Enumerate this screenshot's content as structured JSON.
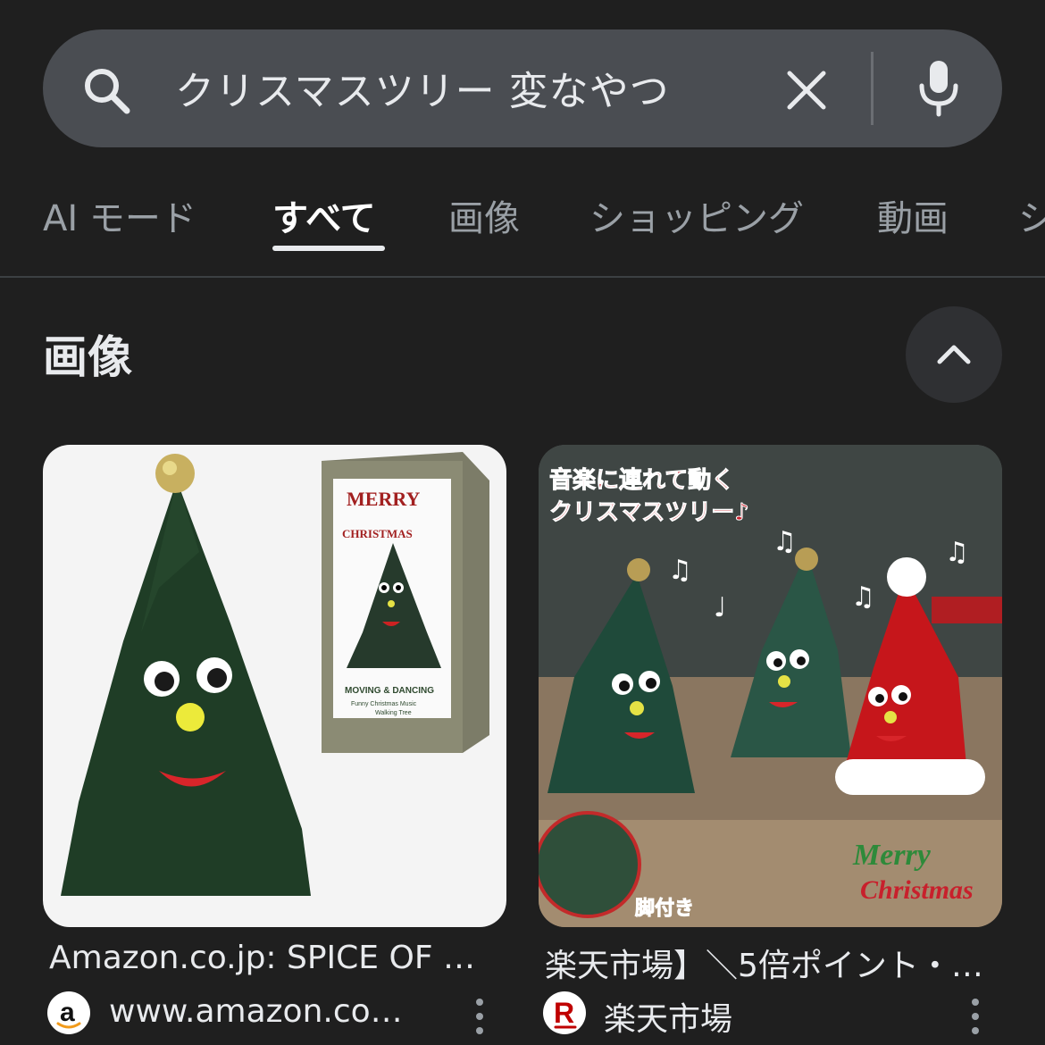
{
  "search": {
    "query": "クリスマスツリー 変なやつ",
    "icons": [
      "search-icon",
      "clear-icon",
      "mic-icon"
    ]
  },
  "tabs": [
    {
      "label": "AI モード"
    },
    {
      "label": "すべて",
      "active": true
    },
    {
      "label": "画像"
    },
    {
      "label": "ショッピング"
    },
    {
      "label": "動画"
    },
    {
      "label": "シ"
    }
  ],
  "images_section": {
    "title": "画像",
    "toggle_icon": "chevron-up-icon"
  },
  "results": [
    {
      "title": "Amazon.co.jp: SPICE OF …",
      "source": "www.amazon.co…",
      "favicon": "amazon-logo",
      "package_text": [
        "MERRY",
        "CHRISTMAS",
        "MOVING & DANCING",
        "Funny Christmas Music",
        "Walking Tree"
      ]
    },
    {
      "title": "楽天市場】＼5倍ポイント・…",
      "source": "楽天市場",
      "favicon": "rakuten-logo",
      "banner_text": [
        "音楽に連れて動く",
        "クリスマスツリー♪"
      ],
      "legs_label": "脚付き",
      "greeting": [
        "Merry",
        "Christmas"
      ]
    }
  ],
  "colors": {
    "background": "#1f1f1f",
    "search_bar": "#4a4d52",
    "text": "#e8eaed",
    "muted_text": "#9aa0a6"
  }
}
